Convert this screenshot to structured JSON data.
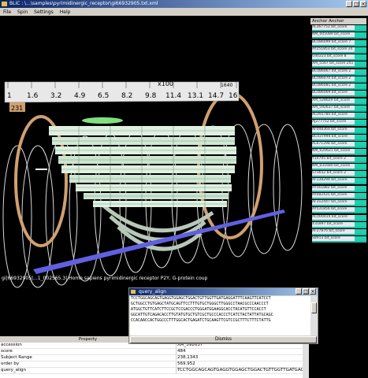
{
  "window": {
    "title": "BLiC : \\...\\samples\\pyrimidinergic_receptor\\gi66932905.txt.xml"
  },
  "menu": [
    {
      "label": "File"
    },
    {
      "label": "Spin"
    },
    {
      "label": "Settings"
    },
    {
      "label": "Help"
    }
  ],
  "viewport": {
    "ruler_multiplier": "x100",
    "ruler_ticks": [
      "1",
      "1.6",
      "3.2",
      "4.9",
      "6.5",
      "8.2",
      "9.8",
      "11.4",
      "13.1",
      "14.7",
      "16"
    ],
    "ruler_end_label": "1640",
    "ruler_marker": "231",
    "caption": "gi|66932905|...1_002565.3| Homo sapiens pyrimidinergic receptor P2Y, G-protein coup"
  },
  "anchor_panel": {
    "header": "Anchor  Anchor",
    "items": [
      {
        "label": "AL367752 bit_score"
      },
      {
        "label": "NM_005089 bit_score"
      },
      {
        "label": "BC086099 bit_score 7"
      },
      {
        "label": "AY251853 bit_score 24"
      },
      {
        "label": "U40223 bit_score 8"
      },
      {
        "label": "XM_5567 bit_score 241"
      },
      {
        "label": "BC086067 bit_score 2"
      },
      {
        "label": "BC086070 bit_score 2"
      },
      {
        "label": "BC086081 bit_score 2"
      },
      {
        "label": "BC086069 bit_score"
      },
      {
        "label": "XM_528029 bit_score"
      },
      {
        "label": "XM_592637 bit_score"
      },
      {
        "label": "AC091784 bit_score"
      },
      {
        "label": "AJ277752 bit_score"
      },
      {
        "label": "AF048364 bit_score"
      },
      {
        "label": "BC037994 bit_score"
      },
      {
        "label": "AL671298 bit_score"
      },
      {
        "label": "NM_020621 bit_score"
      },
      {
        "label": "Y14705 bit_score 2"
      },
      {
        "label": "NM_031680 bit_score"
      },
      {
        "label": "S73652 bit_score 2"
      },
      {
        "label": "AF138294 bit_score"
      },
      {
        "label": "AY561882 bit_score"
      },
      {
        "label": "AY082435 bit_score"
      },
      {
        "label": "AF312447 bit_score"
      },
      {
        "label": "AY531856 bit_score"
      },
      {
        "label": "AC000014 bit_score"
      },
      {
        "label": "X31897 bit_score"
      },
      {
        "label": "AF27876 bit_score"
      },
      {
        "label": "S8913 bit_score"
      }
    ]
  },
  "dialog": {
    "title": "query_align",
    "lines": [
      "TCCTGGCAGCAGTGAGGTGGAGCTGGACTGTTGGTTGATGAGGATTTCAAGTTCATCCT",
      "GCTGGCCTGTGAGCTATGCAGTTCCTTTGTGCTGGGCTTGGGCCTAACGCCCAACCCT",
      "ATGGCTGTTCATCTTCCGCTCCGACCCTGGGATGGAAGGCACCTACATGTTCCACCT",
      "GGCATTGTCAGACACCTTGTATGTGCTGTCGCTGCCCACCCTCATCTACTATTATGCAGC",
      "CCACAACCACTGGCCCTTTGGCACTGAGATCTGCAAGTTCGTCCGCTTTCTTTCTATTG"
    ],
    "dismiss_label": "Dismiss"
  },
  "properties": {
    "headers": [
      "Property",
      ""
    ],
    "rows": [
      {
        "key": "accession",
        "value": "XM_592637"
      },
      {
        "key": "score",
        "value": "484"
      },
      {
        "key": "Subject Range",
        "value": "238,1343"
      },
      {
        "key": "order by",
        "value": "569,952"
      },
      {
        "key": "query_align",
        "value": "TCCTGGCAGCAGTGAGGTGGAGCTGGACTGTTGGTTGATGAGGATTTCAAGTTCATCC"
      }
    ]
  },
  "colors": {
    "background": "#000000",
    "ring_tan": "#d0a070",
    "teal": "#20c0a0",
    "blue_bar": "#6060e0",
    "ruler": "#e8e8e8"
  }
}
